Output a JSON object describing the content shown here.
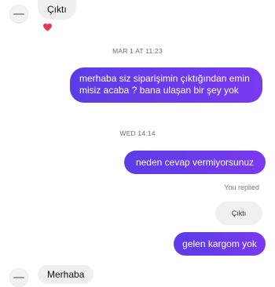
{
  "thread": {
    "first_received": "Çıktı",
    "reaction_icon": "heart-icon",
    "timestamp_1": "MAR 1 AT 11:23",
    "sent_message_1": "merhaba siz siparişimin çıktığından emin misiz acaba ? bana ulaşan bir şey yok",
    "timestamp_2": "WED 14:14",
    "sent_message_2": "neden cevap vermiyorsunuz",
    "replied_label": "You replied",
    "quoted_reply": "Çıktı",
    "sent_message_3": "gelen kargom yok",
    "last_received_partial": "Merhaba"
  },
  "colors": {
    "accent_start": "#5b3ce6",
    "accent_end": "#7a3af0",
    "received_bubble": "#efefef",
    "heart": "#e8394d"
  }
}
